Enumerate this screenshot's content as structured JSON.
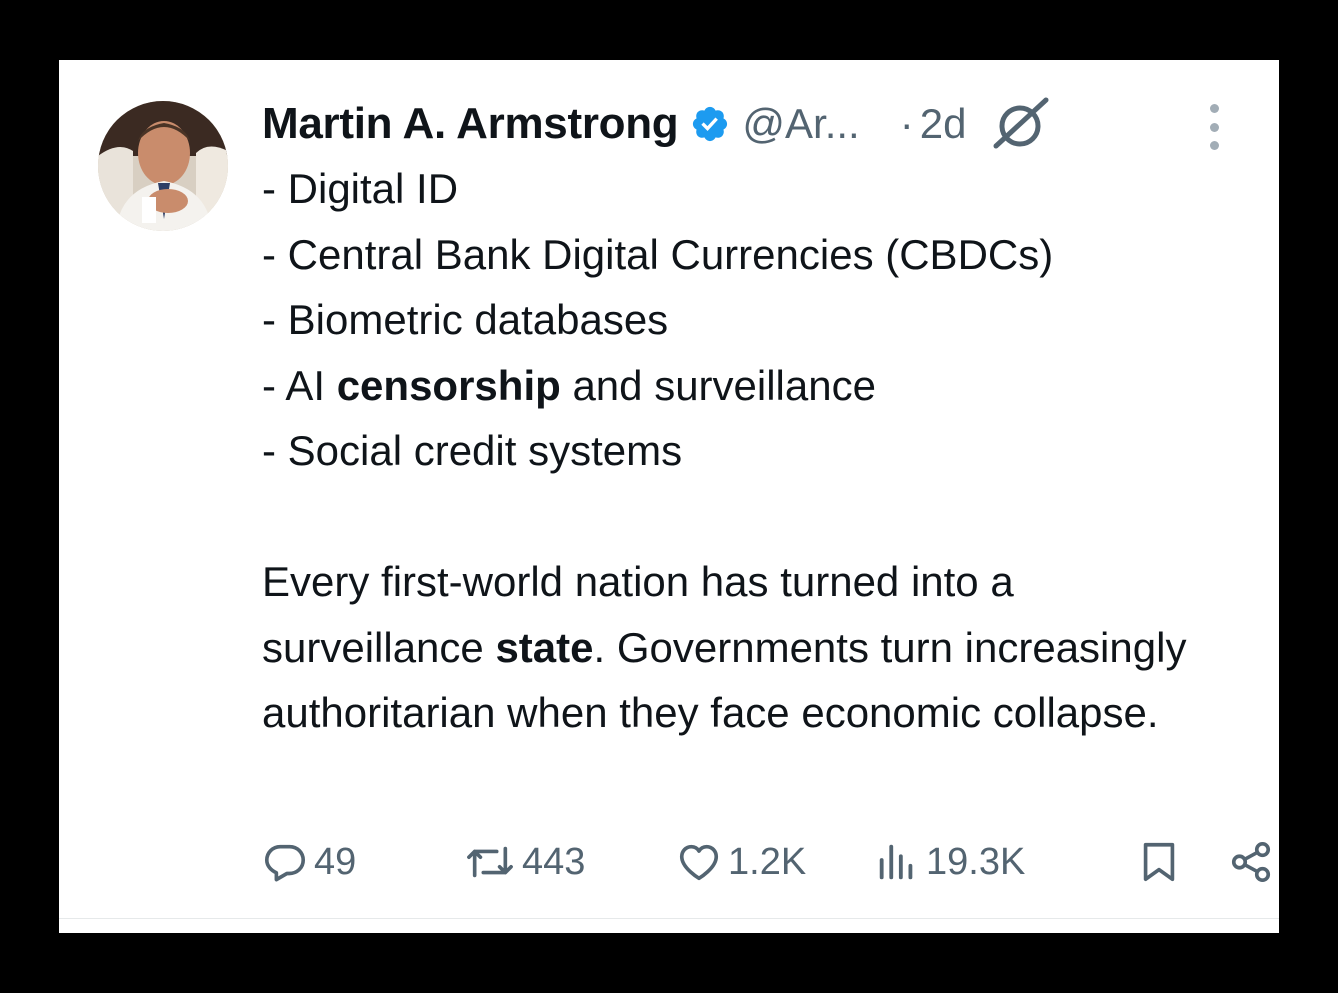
{
  "tweet": {
    "author_name": "Martin A. Armstrong",
    "handle": "@Ar...",
    "dot": "·",
    "time": "2d",
    "lines": [
      "- Digital ID",
      "- Central Bank Digital Currencies (CBDCs)",
      "- Biometric databases"
    ],
    "line4": {
      "prefix": "- AI ",
      "bold": "censorship",
      "suffix": " and surveillance"
    },
    "line5": "- Social credit systems",
    "para2": {
      "part1": "Every first-world nation has turned into a surveillance ",
      "bold": "state",
      "part2": ". Governments turn increasingly authoritarian when they face economic collapse."
    }
  },
  "actions": {
    "replies": "49",
    "reposts": "443",
    "likes": "1.2K",
    "views": "19.3K"
  },
  "icons": {
    "verified": "verified-badge-icon",
    "grok": "grok-icon",
    "more": "more-options-icon",
    "reply": "reply-icon",
    "repost": "repost-icon",
    "like": "heart-icon",
    "views": "views-icon",
    "bookmark": "bookmark-icon",
    "share": "share-icon"
  },
  "colors": {
    "text": "#0f1419",
    "secondary": "#536471",
    "verified": "#1d9bf0",
    "background": "#ffffff",
    "frame": "#000000"
  }
}
